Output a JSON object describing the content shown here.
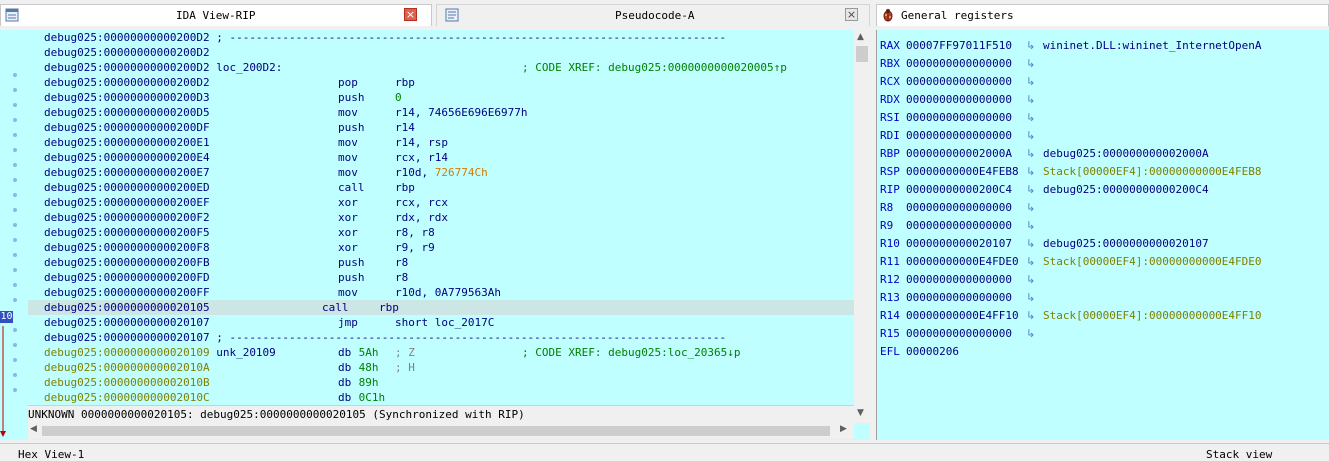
{
  "tabs": {
    "ida_view": {
      "title": "IDA View-RIP",
      "close": "×"
    },
    "pseudocode": {
      "title": "Pseudocode-A",
      "close": "×"
    },
    "registers": {
      "title": "General registers"
    }
  },
  "listing": [
    {
      "addr": "debug025:00000000000200D2",
      "rest": " ; ---------------------------------------------------------------------------",
      "type": "sep"
    },
    {
      "addr": "debug025:00000000000200D2",
      "rest": "",
      "type": "plain"
    },
    {
      "addr": "debug025:00000000000200D2",
      "label": " loc_200D2:",
      "xref": "; CODE XREF: debug025:0000000000020005↑p",
      "type": "label"
    },
    {
      "addr": "debug025:00000000000200D2",
      "mn": "pop",
      "op": "rbp",
      "type": "ins"
    },
    {
      "addr": "debug025:00000000000200D3",
      "mn": "push",
      "op": "0",
      "type": "ins",
      "opnum": true
    },
    {
      "addr": "debug025:00000000000200D5",
      "mn": "mov",
      "op": "r14, 74656E696E6977h",
      "type": "ins"
    },
    {
      "addr": "debug025:00000000000200DF",
      "mn": "push",
      "op": "r14",
      "type": "ins"
    },
    {
      "addr": "debug025:00000000000200E1",
      "mn": "mov",
      "op": "r14, rsp",
      "type": "ins"
    },
    {
      "addr": "debug025:00000000000200E4",
      "mn": "mov",
      "op": "rcx, r14",
      "type": "ins"
    },
    {
      "addr": "debug025:00000000000200E7",
      "mn": "mov",
      "op": "r10d, ",
      "op2": "726774Ch",
      "type": "ins"
    },
    {
      "addr": "debug025:00000000000200ED",
      "mn": "call",
      "op": "rbp",
      "type": "ins"
    },
    {
      "addr": "debug025:00000000000200EF",
      "mn": "xor",
      "op": "rcx, rcx",
      "type": "ins"
    },
    {
      "addr": "debug025:00000000000200F2",
      "mn": "xor",
      "op": "rdx, rdx",
      "type": "ins"
    },
    {
      "addr": "debug025:00000000000200F5",
      "mn": "xor",
      "op": "r8, r8",
      "type": "ins"
    },
    {
      "addr": "debug025:00000000000200F8",
      "mn": "xor",
      "op": "r9, r9",
      "type": "ins"
    },
    {
      "addr": "debug025:00000000000200FB",
      "mn": "push",
      "op": "r8",
      "type": "ins"
    },
    {
      "addr": "debug025:00000000000200FD",
      "mn": "push",
      "op": "r8",
      "type": "ins"
    },
    {
      "addr": "debug025:00000000000200FF",
      "mn": "mov",
      "op": "r10d, 0A779563Ah",
      "type": "ins"
    },
    {
      "addr": "debug025:0000000000020105",
      "mn": "call",
      "op": "rbp",
      "type": "ins",
      "current": true
    },
    {
      "addr": "debug025:0000000000020107",
      "mn": "jmp",
      "op": "short loc_2017C",
      "type": "ins"
    },
    {
      "addr": "debug025:0000000000020107",
      "rest": " ; ---------------------------------------------------------------------------",
      "type": "sep"
    },
    {
      "addr": "debug025:0000000000020109",
      "label": " unk_20109",
      "mn": "db",
      "op": " 5Ah",
      "cmt": "; Z",
      "xref": "; CODE XREF: debug025:loc_20365↓p",
      "type": "data",
      "green": true
    },
    {
      "addr": "debug025:000000000002010A",
      "mn": "db",
      "op": " 48h",
      "cmt": "; H",
      "type": "data",
      "green": true
    },
    {
      "addr": "debug025:000000000002010B",
      "mn": "db",
      "op": " 89h",
      "type": "data",
      "green": true
    },
    {
      "addr": "debug025:000000000002010C",
      "mn": "db",
      "op": " 0C1h",
      "type": "data",
      "green": true
    }
  ],
  "status_line": "UNKNOWN 0000000000020105: debug025:0000000000020105 (Synchronized with RIP)",
  "gutter_marker": "10",
  "registers": [
    {
      "name": "RAX",
      "value": "00007FF97011F510",
      "desc": "wininet.DLL:wininet_InternetOpenA",
      "desc_color": "#000080"
    },
    {
      "name": "RBX",
      "value": "0000000000000000",
      "desc": ""
    },
    {
      "name": "RCX",
      "value": "0000000000000000",
      "desc": ""
    },
    {
      "name": "RDX",
      "value": "0000000000000000",
      "desc": ""
    },
    {
      "name": "RSI",
      "value": "0000000000000000",
      "desc": ""
    },
    {
      "name": "RDI",
      "value": "0000000000000000",
      "desc": ""
    },
    {
      "name": "RBP",
      "value": "000000000002000A",
      "desc": "debug025:000000000002000A",
      "desc_color": "#000080"
    },
    {
      "name": "RSP",
      "value": "00000000000E4FEB8",
      "desc": "Stack[00000EF4]:00000000000E4FEB8",
      "desc_color": "#808000"
    },
    {
      "name": "RIP",
      "value": "00000000000200C4",
      "desc": "debug025:00000000000200C4",
      "desc_color": "#000080"
    },
    {
      "name": "R8",
      "value": "0000000000000000",
      "desc": ""
    },
    {
      "name": "R9",
      "value": "0000000000000000",
      "desc": ""
    },
    {
      "name": "R10",
      "value": "0000000000020107",
      "desc": "debug025:0000000000020107",
      "desc_color": "#000080"
    },
    {
      "name": "R11",
      "value": "00000000000E4FDE0",
      "desc": "Stack[00000EF4]:00000000000E4FDE0",
      "desc_color": "#808000"
    },
    {
      "name": "R12",
      "value": "0000000000000000",
      "desc": ""
    },
    {
      "name": "R13",
      "value": "0000000000000000",
      "desc": ""
    },
    {
      "name": "R14",
      "value": "00000000000E4FF10",
      "desc": "Stack[00000EF4]:00000000000E4FF10",
      "desc_color": "#808000"
    },
    {
      "name": "R15",
      "value": "0000000000000000",
      "desc": ""
    },
    {
      "name": "EFL",
      "value": "00000206",
      "desc": "",
      "no_arrow": true
    }
  ],
  "bottom": {
    "left_title": "Hex View-1",
    "right_title": "Stack view"
  }
}
